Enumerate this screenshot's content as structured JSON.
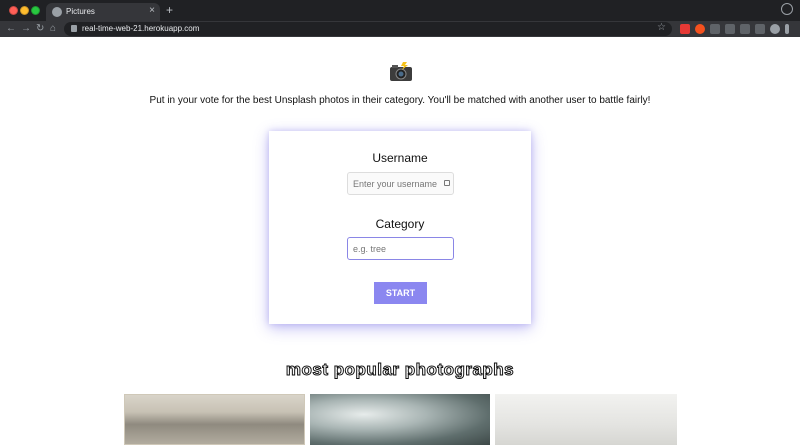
{
  "browser": {
    "tab_title": "Pictures",
    "tab_close": "×",
    "new_tab": "+",
    "url": "real-time-web-21.herokuapp.com",
    "nav": {
      "back": "←",
      "forward": "→",
      "reload": "↻",
      "home": "⌂",
      "bookmark": "☆"
    }
  },
  "page": {
    "logo_icon": "camera-with-flash-icon",
    "intro": "Put in your vote for the best Unsplash photos in their category. You'll be matched with another user to battle fairly!",
    "form": {
      "username_label": "Username",
      "username_placeholder": "Enter your username",
      "category_label": "Category",
      "category_placeholder": "e.g. tree",
      "start_label": "START"
    },
    "popular_heading": "most popular photographs"
  },
  "colors": {
    "accent": "#8b87f0",
    "card_shadow": "#786ee6",
    "chrome_dark": "#202124"
  }
}
